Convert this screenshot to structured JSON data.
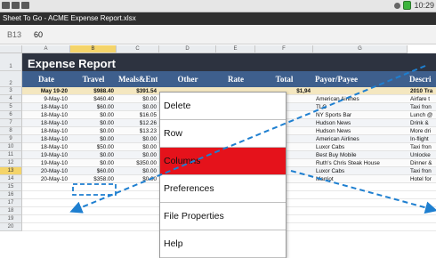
{
  "statusbar": {
    "time": "10:29"
  },
  "app_title": "Sheet To Go - ACME Expense Report.xlsx",
  "formula": {
    "cell_ref": "B13",
    "value": "60"
  },
  "columns": [
    "A",
    "B",
    "C",
    "D",
    "E",
    "F",
    "G"
  ],
  "rows": [
    "1",
    "2",
    "3",
    "4",
    "5",
    "6",
    "7",
    "8",
    "9",
    "10",
    "11",
    "12",
    "13",
    "14",
    "15",
    "16",
    "17",
    "18",
    "19",
    "20"
  ],
  "sheet": {
    "title": "Expense Report",
    "headers": [
      "Date",
      "Travel",
      "Meals&Ent",
      "Other",
      "Rate",
      "Total",
      "Payor/Payee",
      "Descri"
    ],
    "data": [
      [
        "May 19-20",
        "$988.40",
        "$391.54",
        "",
        "",
        "$1,94",
        "",
        "2010 Tra"
      ],
      [
        "9-May-10",
        "$460.40",
        "$0.00",
        "",
        "",
        "",
        "American Airlines",
        "Airfare t"
      ],
      [
        "18-May-10",
        "$60.00",
        "$0.00",
        "",
        "",
        "",
        "TLC",
        "Taxi fron"
      ],
      [
        "18-May-10",
        "$0.00",
        "$16.05",
        "",
        "",
        "",
        "NY Sports Bar",
        "Lunch @"
      ],
      [
        "18-May-10",
        "$0.00",
        "$12.26",
        "",
        "",
        "",
        "Hudson News",
        "Drink &"
      ],
      [
        "18-May-10",
        "$0.00",
        "$13.23",
        "",
        "",
        "",
        "Hudson News",
        "More dri"
      ],
      [
        "18-May-10",
        "$0.00",
        "$0.00",
        "",
        "",
        "",
        "American Airlines",
        "In-flight"
      ],
      [
        "18-May-10",
        "$50.00",
        "$0.00",
        "",
        "",
        "",
        "Luxor Cabs",
        "Taxi fron"
      ],
      [
        "19-May-10",
        "$0.00",
        "$0.00",
        "",
        "",
        "",
        "Best Buy Mobile",
        "Unlocke"
      ],
      [
        "19-May-10",
        "$0.00",
        "$350.00",
        "",
        "",
        "",
        "Ruth's Chris Steak House",
        "Dinner &"
      ],
      [
        "20-May-10",
        "$60.00",
        "$0.00",
        "",
        "",
        "",
        "Luxor Cabs",
        "Taxi fron"
      ],
      [
        "20-May-10",
        "$358.00",
        "$0.00",
        "",
        "",
        "",
        "Marriot",
        "Hotel for"
      ]
    ]
  },
  "menu": {
    "items": [
      "Delete",
      "Row",
      "Columns",
      "Preferences",
      "File Properties",
      "Help"
    ],
    "active_index": 2
  },
  "colors": {
    "banner": "#2d3340",
    "header": "#3e5f8d",
    "selection": "#f4d46a",
    "menu_active": "#e5121b",
    "annotation": "#1e7fd0"
  }
}
